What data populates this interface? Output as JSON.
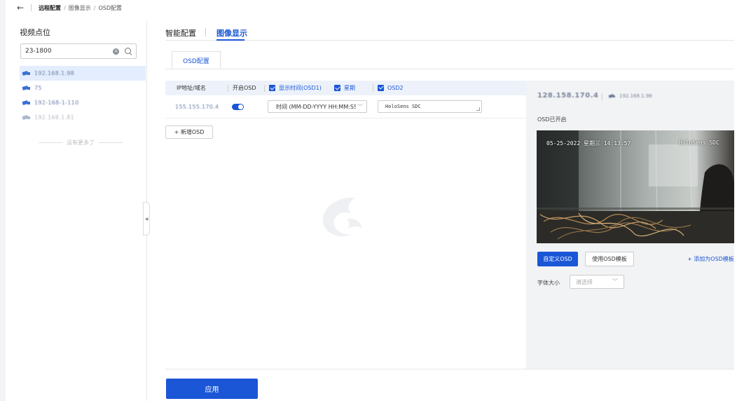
{
  "breadcrumb": {
    "back_icon": "arrow-left-icon",
    "items": [
      "远程配置",
      "图像显示",
      "OSD配置"
    ]
  },
  "left_panel": {
    "title": "视频点位",
    "search": {
      "value": "23-1800",
      "placeholder": ""
    },
    "cameras": [
      {
        "label": "192.168.1.98",
        "active": true,
        "online": true
      },
      {
        "label": "75",
        "active": false,
        "online": true
      },
      {
        "label": "192-168-1-110",
        "active": false,
        "online": true
      },
      {
        "label": "192.168.1.81",
        "active": false,
        "online": false
      }
    ],
    "no_more": "没有更多了"
  },
  "tabs": {
    "items": [
      "智能配置",
      "图像显示"
    ],
    "active_index": 1
  },
  "sub_tab": "OSD配置",
  "table": {
    "headers": {
      "ip": "IP地址/域名",
      "enable": "开启OSD",
      "osd1": "显示时间(OSD1)",
      "week": "星期",
      "osd2": "OSD2"
    },
    "row": {
      "ip": "155.155.170.4",
      "enabled": true,
      "time_format": "时间 (MM-DD-YYYY HH:MM:SS)",
      "osd2_text": "HoloSens SDC"
    }
  },
  "add_osd_label": "+ 新增OSD",
  "preview_panel": {
    "ip": "128.158.170.4",
    "camera_label": "192.168.1.98",
    "status": "OSD已开启",
    "overlay_datetime": "05-25-2022 星期三 14:13:57",
    "overlay_osd2": "HoloSens SDC",
    "custom_button": "自定义OSD",
    "template_button": "使用OSD模板",
    "add_template_link": "+ 添加为OSD模板",
    "font_size_label": "字体大小",
    "font_size_placeholder": "请选择"
  },
  "apply_button": "应用",
  "colors": {
    "accent": "#1a56d6",
    "table_header": "#edf2fa",
    "panel_bg": "#f2f3f5"
  }
}
